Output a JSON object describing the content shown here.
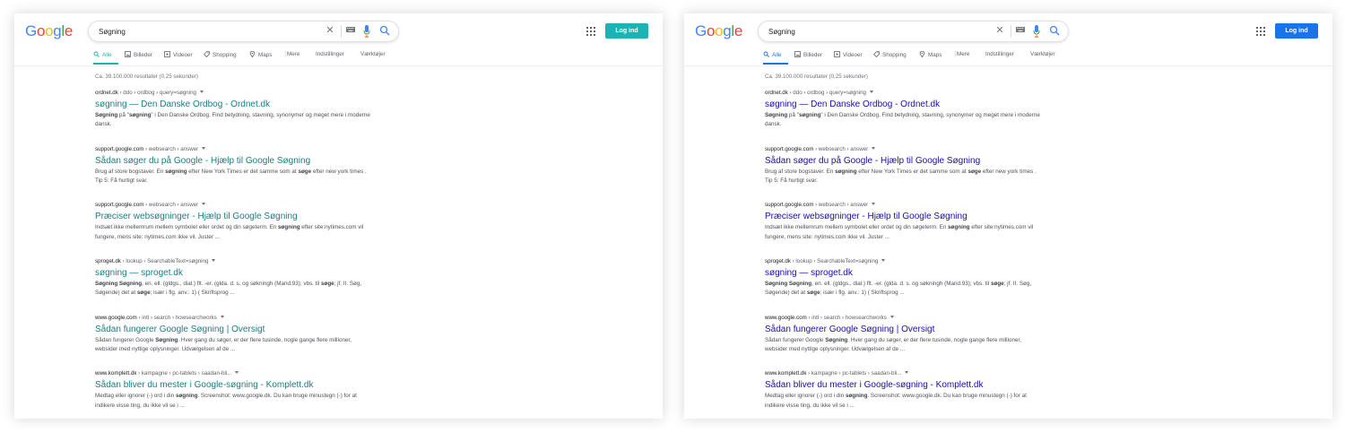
{
  "logo": {
    "letters": [
      "G",
      "o",
      "o",
      "g",
      "l",
      "e"
    ]
  },
  "search": {
    "query": "Søgning",
    "placeholder": ""
  },
  "login_label": "Log ind",
  "tabs": [
    {
      "label": "Alle",
      "icon": "search-icon",
      "active": true
    },
    {
      "label": "Billeder",
      "icon": "image-icon"
    },
    {
      "label": "Videoer",
      "icon": "video-icon"
    },
    {
      "label": "Shopping",
      "icon": "tag-icon"
    },
    {
      "label": "Maps",
      "icon": "map-pin-icon"
    },
    {
      "label": "Mere",
      "icon": "more-vert-icon"
    },
    {
      "label": "Indstillinger"
    },
    {
      "label": "Værktøjer"
    }
  ],
  "stats": "Ca. 39.100.000 resultater (0,25 sekunder)",
  "results": [
    {
      "domain": "ordnet.dk",
      "path": " › ddo › ordbog › query=søgning",
      "title": "søgning — Den Danske Ordbog - Ordnet.dk",
      "snippet_html": "<b>Søgning</b> på \"<b>søgning</b>\" i Den Danske Ordbog. Find betydning, stavning, synonymer og meget mere i moderne dansk."
    },
    {
      "domain": "support.google.com",
      "path": " › websearch › answer",
      "title": "Sådan søger du på Google - Hjælp til Google Søgning",
      "snippet_html": "Brug af store bogstaver. En <b>søgning</b> efter New York Times er det samme som at <b>søge</b> efter new york times . Tip 5: Få hurtigt svar."
    },
    {
      "domain": "support.google.com",
      "path": " › websearch › answer",
      "title": "Præciser websøgninger - Hjælp til Google Søgning",
      "snippet_html": "Indsæt ikke mellemrum mellem symbolet eller ordet og din søgeterm. En <b>søgning</b> efter site:nytimes.com vil fungere, mens site: nytimes.com ikke vil. Juster ..."
    },
    {
      "domain": "sproget.dk",
      "path": " › lookup › SearchableText=søgning",
      "title": "søgning — sproget.dk",
      "snippet_html": "<b>Søgning Søgning</b>, en. ell. (gldgs., dial.) flt. -er. (glda. d. s. og søkningh (Mand.93); vbs. til <b>søge</b>; jf. II. Søg, Søgende) det at <b>søge</b>; især i flg. anv.: 1) ( Skriftsprog ..."
    },
    {
      "domain": "www.google.com",
      "path": " › intl › search › howsearchworks",
      "title": "Sådan fungerer Google Søgning | Oversigt",
      "snippet_html": "Sådan fungerer Google <b>Søgning</b>. Hver gang du søger, er der flere tusinde, nogle gange flere millioner, websider med nyttige oplysninger. Udvælgelsen af de ..."
    },
    {
      "domain": "www.komplett.dk",
      "path": " › kampagne › pc-tablets › saadan-bli...",
      "title": "Sådan bliver du mester i Google-søgning - Komplett.dk",
      "snippet_html": "Medtag eller ignorer (-) ord i din <b>søgning</b>. Screenshot: www.google.dk. Du kan bruge minustegn (-) for at indikere visse ting, du ikke vil se i ..."
    }
  ],
  "themes": {
    "left": {
      "accent": "#1bb3b5",
      "title_color": "#177f83"
    },
    "right": {
      "accent": "#1a73e8",
      "title_color": "#1a0dab"
    }
  }
}
